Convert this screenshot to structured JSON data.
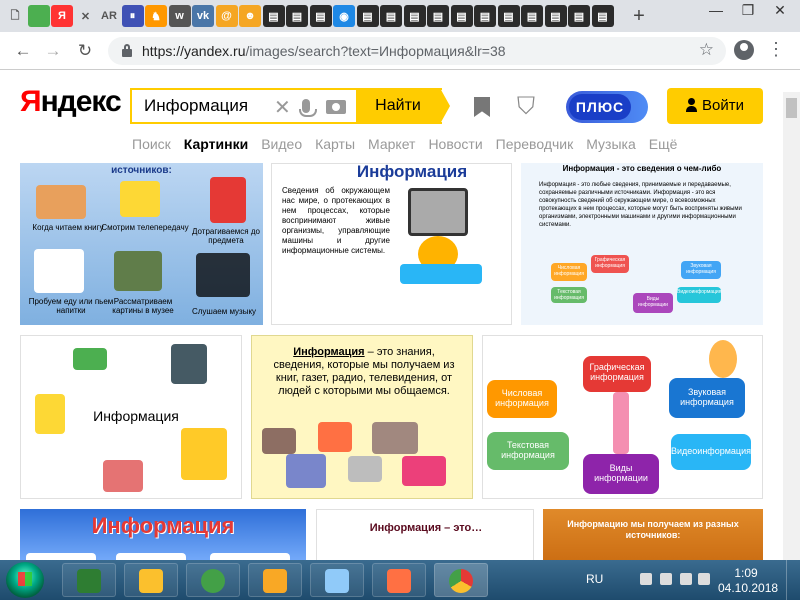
{
  "browser": {
    "tabs": [
      {
        "icon": "document-icon",
        "color": "#dee1e6",
        "glyph": "🗋"
      },
      {
        "icon": "green-square-icon",
        "color": "#4caf50",
        "glyph": ""
      },
      {
        "icon": "yandex-icon",
        "color": "#f33",
        "glyph": "Я"
      },
      {
        "icon": "close-tab-icon",
        "color": "#dee1e6",
        "glyph": "✕"
      },
      {
        "icon": "ar-icon",
        "color": "#dee1e6",
        "glyph": "AR"
      },
      {
        "icon": "pause-icon",
        "color": "#3f51b5",
        "glyph": "⏸"
      },
      {
        "icon": "cat-icon",
        "color": "#ff9800",
        "glyph": "♞"
      },
      {
        "icon": "w-icon",
        "color": "#555",
        "glyph": "w"
      },
      {
        "icon": "vk-icon",
        "color": "#4a76a8",
        "glyph": "vk"
      },
      {
        "icon": "at-icon",
        "color": "#f5a623",
        "glyph": "@"
      },
      {
        "icon": "lion-icon",
        "color": "#f5a623",
        "glyph": "☻"
      },
      {
        "icon": "page-icon",
        "color": "#2b2b2b",
        "glyph": "▤"
      },
      {
        "icon": "page-icon",
        "color": "#2b2b2b",
        "glyph": "▤"
      },
      {
        "icon": "page-icon",
        "color": "#2b2b2b",
        "glyph": "▤"
      },
      {
        "icon": "globe-icon",
        "color": "#1e88e5",
        "glyph": "◉"
      },
      {
        "icon": "page-icon",
        "color": "#2b2b2b",
        "glyph": "▤"
      },
      {
        "icon": "page-icon",
        "color": "#2b2b2b",
        "glyph": "▤"
      },
      {
        "icon": "page-icon",
        "color": "#2b2b2b",
        "glyph": "▤"
      },
      {
        "icon": "page-icon",
        "color": "#2b2b2b",
        "glyph": "▤"
      },
      {
        "icon": "page-icon",
        "color": "#2b2b2b",
        "glyph": "▤"
      },
      {
        "icon": "page-icon",
        "color": "#2b2b2b",
        "glyph": "▤"
      },
      {
        "icon": "page-icon",
        "color": "#2b2b2b",
        "glyph": "▤"
      },
      {
        "icon": "page-icon",
        "color": "#2b2b2b",
        "glyph": "▤"
      },
      {
        "icon": "page-icon",
        "color": "#2b2b2b",
        "glyph": "▤"
      },
      {
        "icon": "page-icon",
        "color": "#2b2b2b",
        "glyph": "▤"
      },
      {
        "icon": "page-icon",
        "color": "#2b2b2b",
        "glyph": "▤"
      }
    ],
    "new_tab": "+",
    "window": {
      "minimize": "—",
      "restore": "❐",
      "close": "✕"
    },
    "nav": {
      "back": "←",
      "forward": "→",
      "reload": "↻"
    },
    "url_host": "https://yandex.ru",
    "url_path": "/images/search?text=Информация&lr=38",
    "star": "☆",
    "menu": "⋮"
  },
  "yandex": {
    "logo_first": "Я",
    "logo_rest": "ндекс",
    "query": "Информация",
    "clear": "✕",
    "find": "Найти",
    "shield": "⛉",
    "plus": "ПЛЮС",
    "login": "Войти",
    "services": [
      "Поиск",
      "Картинки",
      "Видео",
      "Карты",
      "Маркет",
      "Новости",
      "Переводчик",
      "Музыка",
      "Ещё"
    ]
  },
  "images": {
    "c1_title": "источников:",
    "c1_labels": [
      "Когда читаем книгу",
      "Смотрим телепередачу",
      "Дотрагиваемся до предмета",
      "Пробуем еду или пьем напитки",
      "Рассматриваем картины в музее",
      "Слушаем музыку"
    ],
    "c2_title": "Информация",
    "c2_text": "Сведения об окружающем нас мире, о протекающих в нем процессах, которые воспринимают живые организмы, управляющие машины и другие информационные системы.",
    "c3_title": "Информация - это сведения о чем-либо",
    "c3_text": "Информация - это любые сведения, принимаемые и передаваемые, сохраняемые различными источниками. Информация - это вся совокупность сведений об окружающем мире, о всевозможных протекающих в нем процессах, которые могут быть восприняты живыми организмами, электронными машинами и другими информационными системами.",
    "c3_nodes": [
      "Числовая информация",
      "Графическая информация",
      "Звуковая информация",
      "Текстовая информация",
      "Видеоинформация",
      "Виды информации"
    ],
    "c4_label": "Информация",
    "c5_word": "Информация",
    "c5_text": " – это знания, сведения, которые мы получаем из книг, газет, радио, телевидения, от людей с которыми мы общаемся.",
    "c6_nodes": [
      "Числовая информация",
      "Графическая информация",
      "Звуковая информация",
      "Текстовая информация",
      "Видеоинформация",
      "Виды информации"
    ],
    "c7_title": "Информация",
    "c8_title": "Информация – это…",
    "c9_title": "Информацию мы получаем из разных источников:"
  },
  "taskbar": {
    "lang": "RU",
    "time": "1:09",
    "date": "04.10.2018"
  }
}
